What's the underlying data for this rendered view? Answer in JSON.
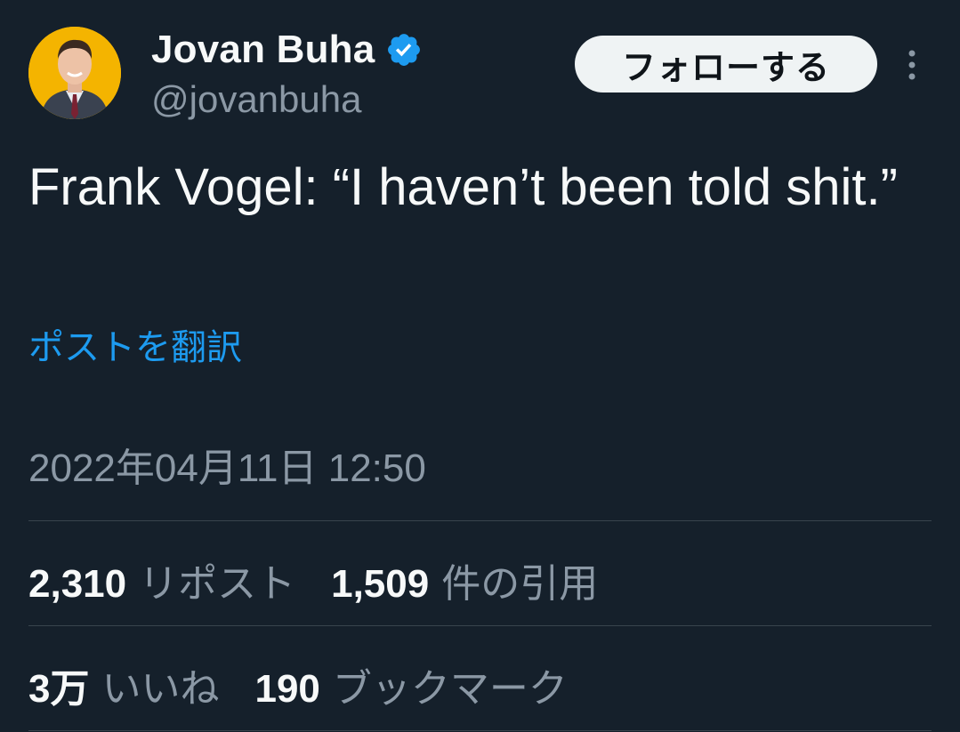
{
  "user": {
    "display_name": "Jovan Buha",
    "handle": "@jovanbuha",
    "verified_icon": "verified-badge-icon",
    "follow_label": "フォローする"
  },
  "tweet": {
    "text": "Frank Vogel: “I haven’t been told shit.”",
    "translate_label": "ポストを翻訳",
    "timestamp": "2022年04月11日 12:50"
  },
  "stats": {
    "reposts_count": "2,310",
    "reposts_label": "リポスト",
    "quotes_count": "1,509",
    "quotes_label": "件の引用",
    "likes_count": "3万",
    "likes_label": "いいね",
    "bookmarks_count": "190",
    "bookmarks_label": "ブックマーク"
  },
  "colors": {
    "background": "#15202b",
    "text": "#f7f9f9",
    "muted": "#8b98a5",
    "accent": "#1d9bf0",
    "divider": "#38444d"
  }
}
